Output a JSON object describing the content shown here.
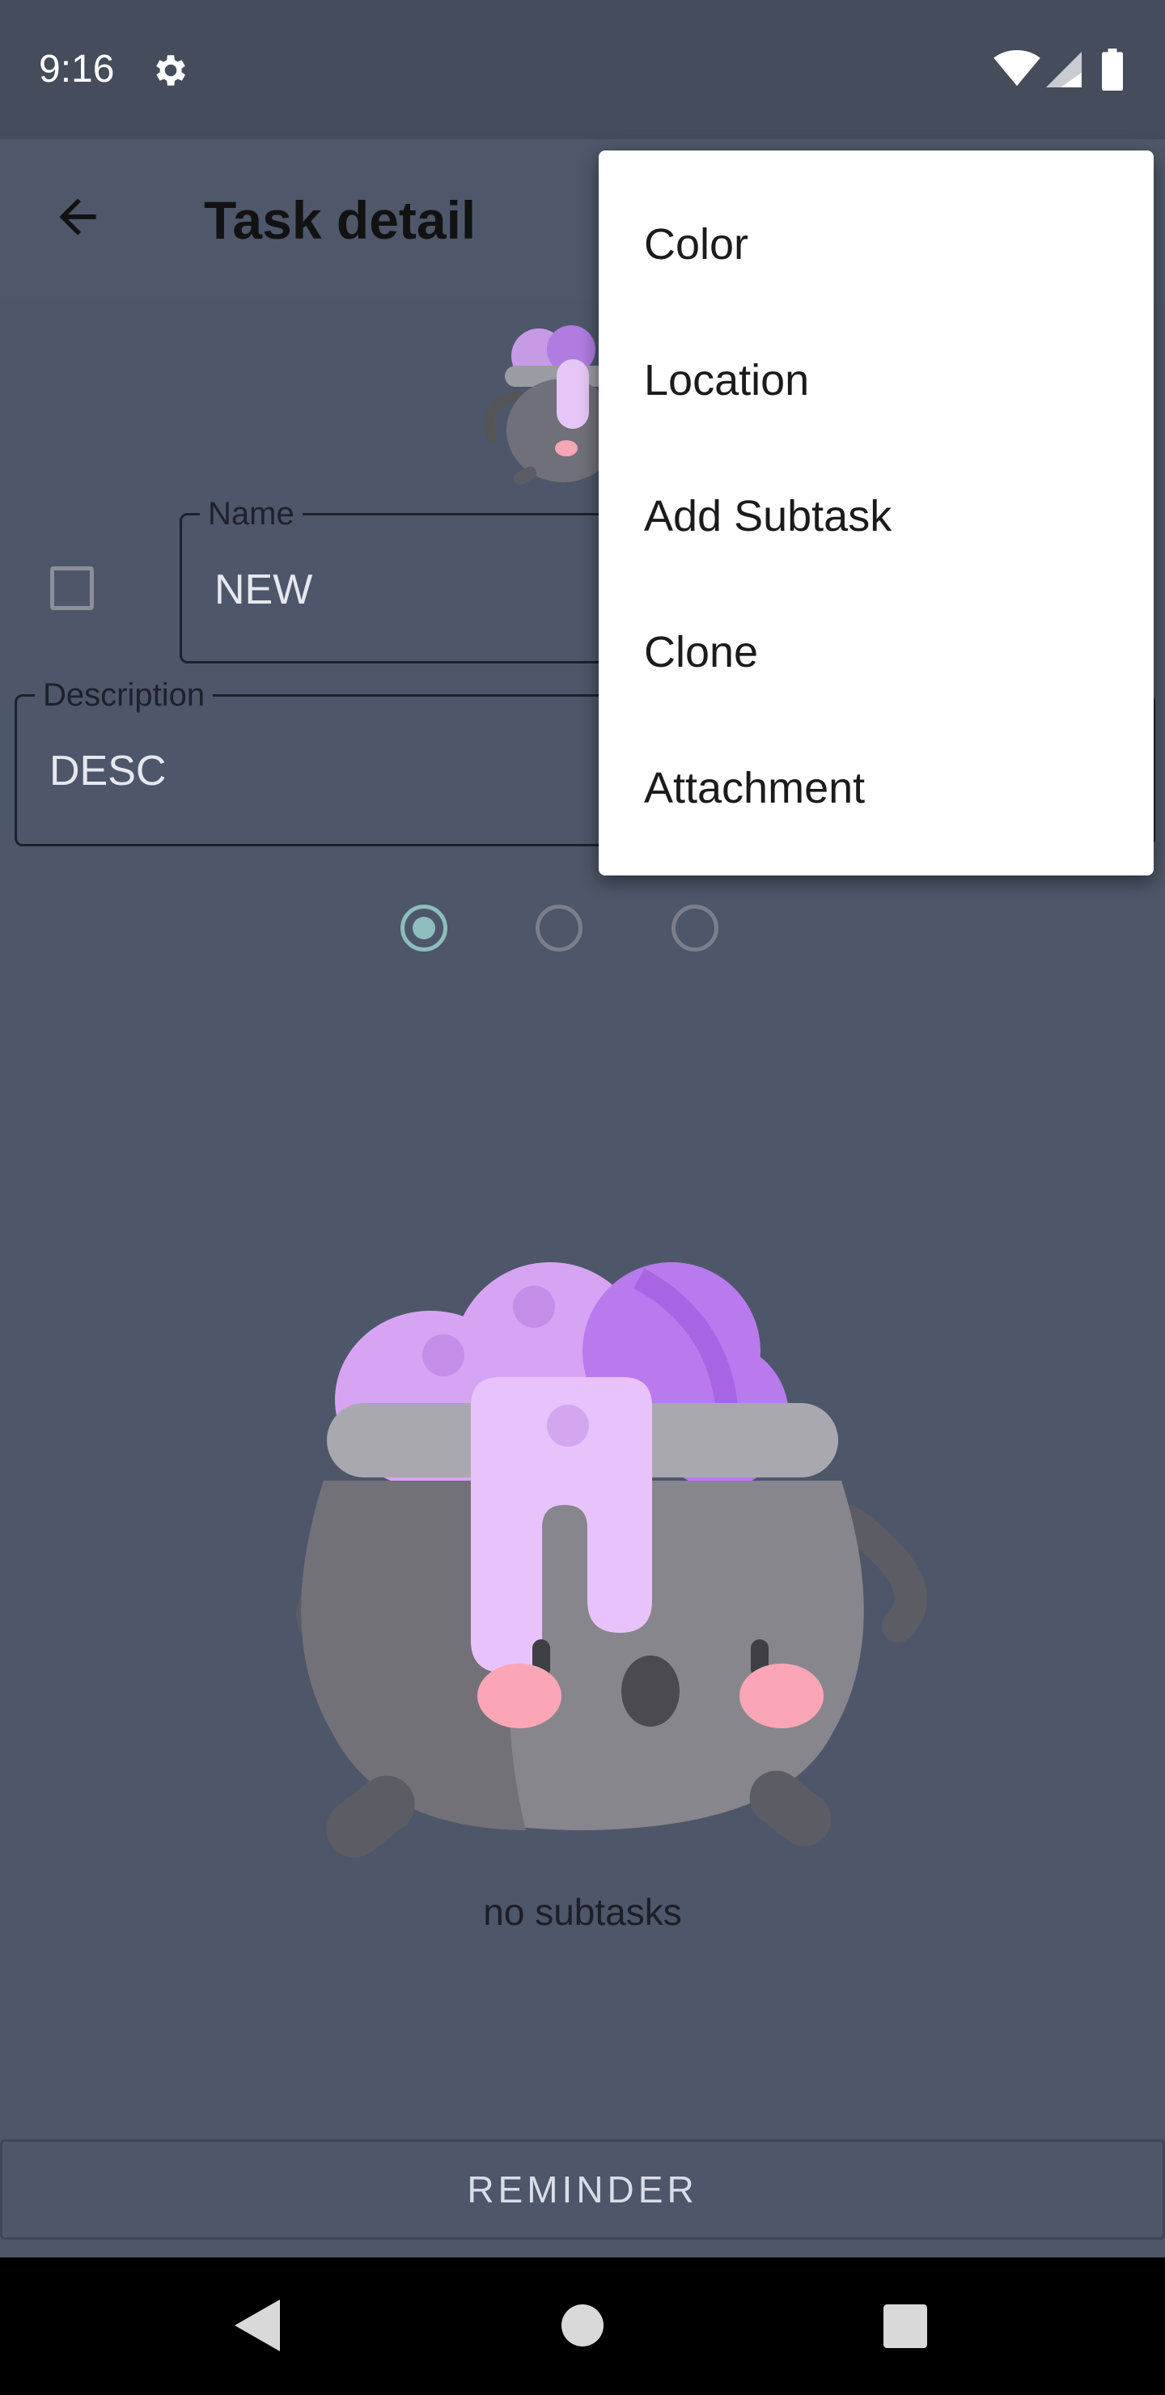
{
  "status_bar": {
    "time": "9:16",
    "icons": [
      "settings-icon",
      "wifi-icon",
      "signal-icon",
      "battery-icon"
    ]
  },
  "app_bar": {
    "title": "Task detail",
    "back_icon": "arrow-back-icon"
  },
  "form": {
    "name_label": "Name",
    "name_value": "NEW",
    "description_label": "Description",
    "description_value": "DESC",
    "completed": false
  },
  "priority": {
    "options": 3,
    "selected_index": 0,
    "accent": "#8fbdbd"
  },
  "subtasks": {
    "empty_text": "no subtasks"
  },
  "reminder_button": "REMINDER",
  "menu": {
    "items": [
      "Color",
      "Location",
      "Add Subtask",
      "Clone",
      "Attachment"
    ]
  },
  "nav_bar": {
    "icons": [
      "back-triangle-icon",
      "home-circle-icon",
      "recents-square-icon"
    ]
  }
}
